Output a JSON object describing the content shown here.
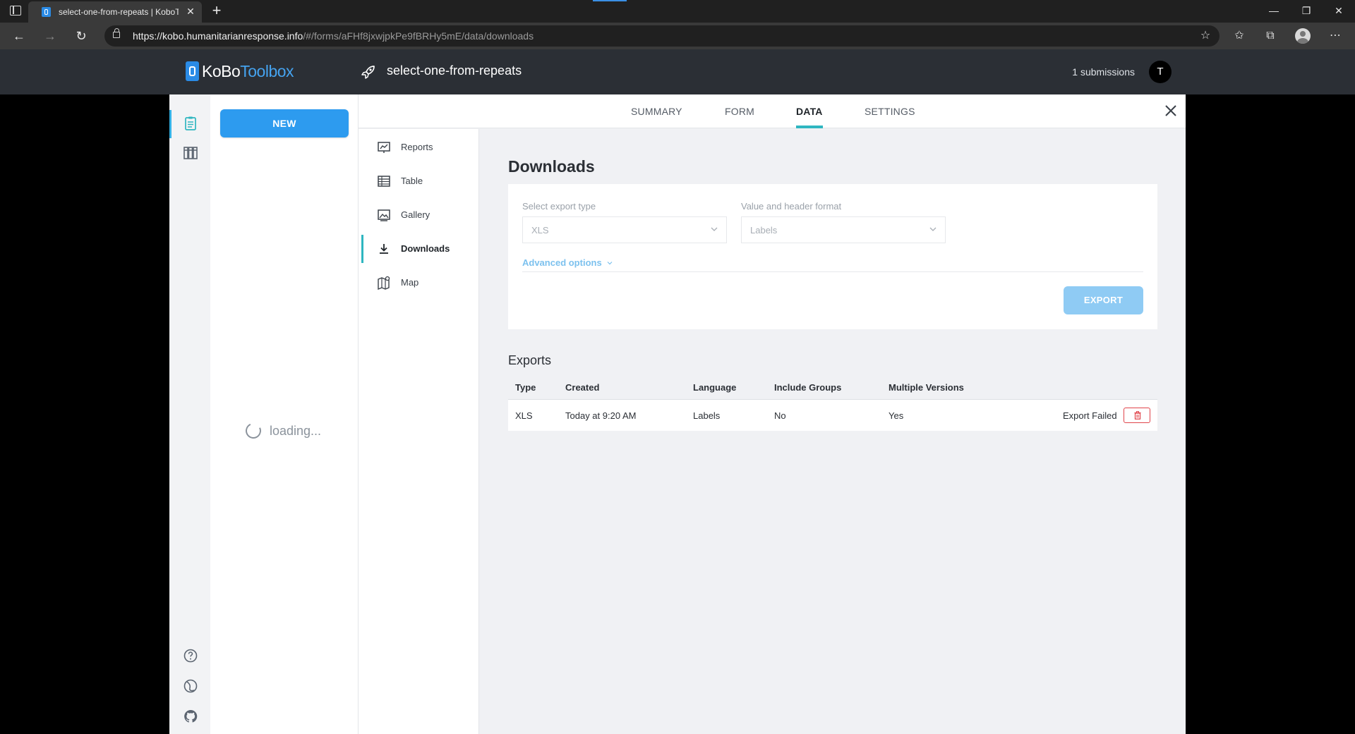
{
  "browser": {
    "tab_title": "select-one-from-repeats | KoboToolbox",
    "url_host": "https://kobo.humanitarianresponse.info",
    "url_path": "/#/forms/aFHf8jxwjpkPe9fBRHy5mE/data/downloads"
  },
  "header": {
    "logo_bold": "KoBo",
    "logo_light": "Toolbox",
    "form_title": "select-one-from-repeats",
    "submissions": "1 submissions",
    "avatar_initial": "T"
  },
  "drawer": {
    "new_label": "NEW",
    "loading": "loading..."
  },
  "tabs": {
    "summary": "SUMMARY",
    "form": "FORM",
    "data": "DATA",
    "settings": "SETTINGS"
  },
  "subnav": {
    "reports": "Reports",
    "table": "Table",
    "gallery": "Gallery",
    "downloads": "Downloads",
    "map": "Map"
  },
  "downloads": {
    "title": "Downloads",
    "export_type_label": "Select export type",
    "export_type_value": "XLS",
    "format_label": "Value and header format",
    "format_value": "Labels",
    "advanced": "Advanced options",
    "export_button": "EXPORT"
  },
  "exports": {
    "title": "Exports",
    "headers": {
      "type": "Type",
      "created": "Created",
      "language": "Language",
      "groups": "Include Groups",
      "versions": "Multiple Versions"
    },
    "rows": [
      {
        "type": "XLS",
        "created": "Today at 9:20 AM",
        "language": "Labels",
        "groups": "No",
        "versions": "Yes",
        "status": "Export Failed"
      }
    ]
  },
  "colors": {
    "accent_teal": "#2fb6c0",
    "primary_blue": "#2d9bef",
    "danger": "#e0444a",
    "header_bg": "#2b2f35"
  }
}
